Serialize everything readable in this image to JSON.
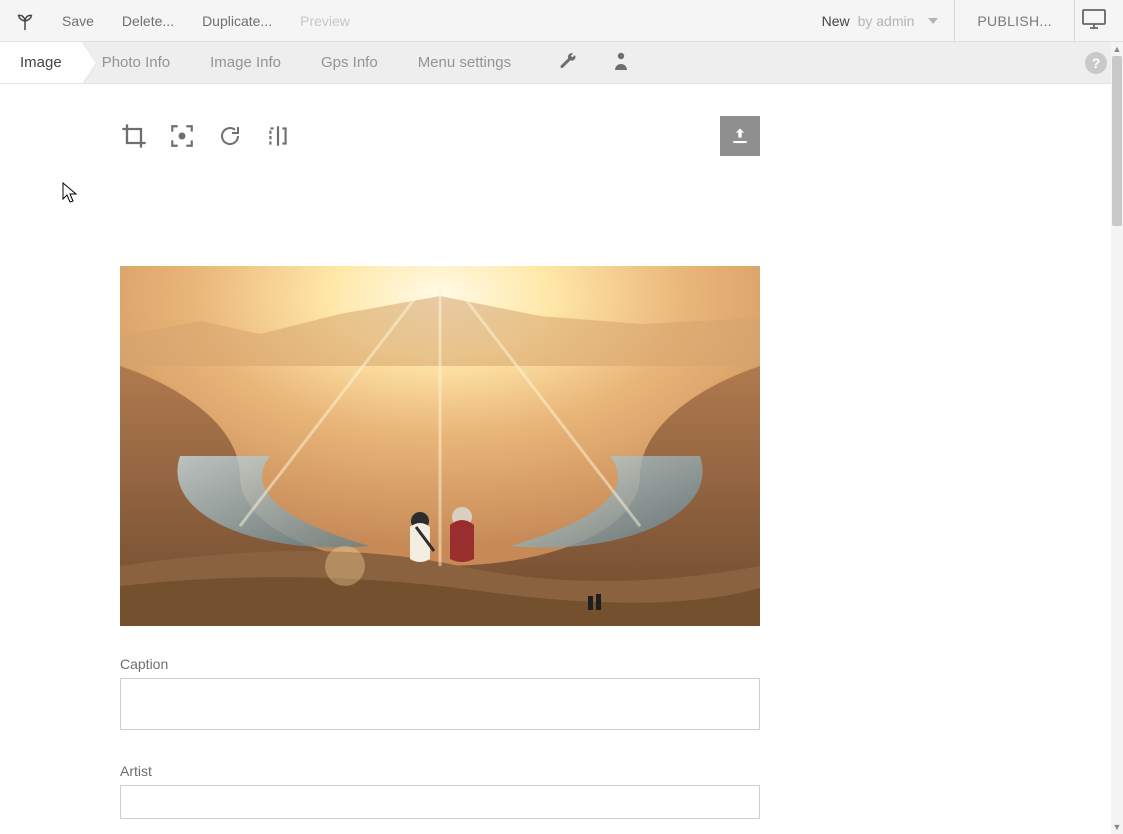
{
  "topbar": {
    "actions": {
      "save": "Save",
      "delete": "Delete...",
      "duplicate": "Duplicate...",
      "preview": "Preview"
    },
    "status": {
      "new": "New",
      "by": "by admin"
    },
    "publish": "PUBLISH..."
  },
  "tabs": {
    "image": "Image",
    "photo_info": "Photo Info",
    "image_info": "Image Info",
    "gps_info": "Gps Info",
    "menu_settings": "Menu settings"
  },
  "help_symbol": "?",
  "fields": {
    "caption": {
      "label": "Caption",
      "value": ""
    },
    "artist": {
      "label": "Artist",
      "value": ""
    }
  }
}
